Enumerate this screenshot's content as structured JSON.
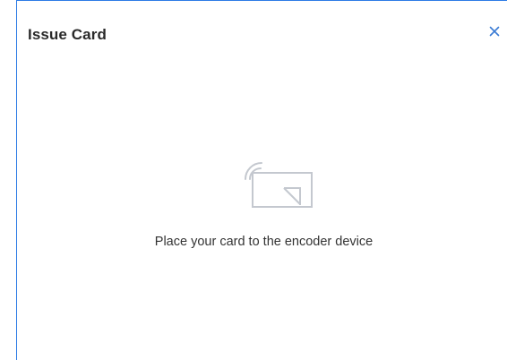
{
  "dialog": {
    "title": "Issue Card",
    "close_icon": "close-icon",
    "accent_color": "#2d7be5"
  },
  "body": {
    "illustration_icon": "card-encoder-icon",
    "instruction": "Place your card to the encoder device"
  }
}
